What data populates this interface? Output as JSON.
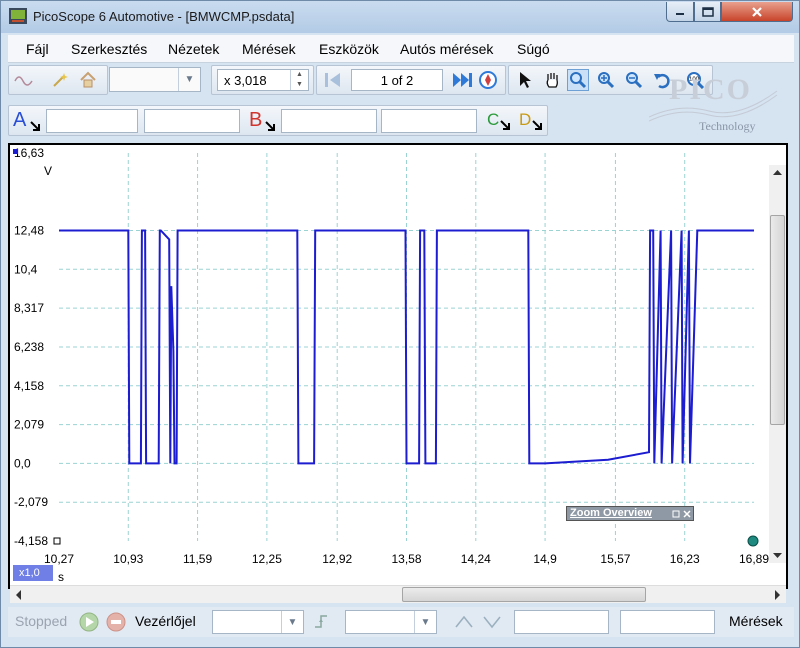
{
  "window": {
    "title": "PicoScope 6 Automotive - [BMWCMP.psdata]"
  },
  "menu": [
    "Fájl",
    "Szerkesztés",
    "Nézetek",
    "Mérések",
    "Eszközök",
    "Autós mérések",
    "Súgó"
  ],
  "toolbar": {
    "zoom_value": "x 3,018",
    "page_indicator": "1 of 2",
    "channel_a": "A",
    "channel_b": "B",
    "channel_c": "C",
    "channel_d": "D",
    "logo_text": "PICO",
    "logo_sub": "Technology"
  },
  "scope": {
    "y_unit": "V",
    "x_unit": "s",
    "x_multiplier": "x1,0",
    "zoom_overview_label": "Zoom Overview",
    "y_ticks": [
      "16,63",
      "12,48",
      "10,4",
      "8,317",
      "6,238",
      "4,158",
      "2,079",
      "0,0",
      "-2,079",
      "-4,158"
    ],
    "x_ticks": [
      "10,27",
      "10,93",
      "11,59",
      "12,25",
      "12,92",
      "13,58",
      "14,24",
      "14,9",
      "15,57",
      "16,23",
      "16,89"
    ],
    "trace_color": "#1c1cd0",
    "grid_color": "#9bd3d3"
  },
  "statusbar": {
    "state": "Stopped",
    "trigger_label": "Vezérlőjel",
    "measurements_label": "Mérések"
  },
  "chart_data": {
    "type": "line",
    "ylabel": "V",
    "xlabel": "s",
    "xlim": [
      10.27,
      16.89
    ],
    "ylim": [
      -4.158,
      16.63
    ],
    "series": [
      {
        "x": [
          10.27,
          10.93,
          10.94,
          11.05,
          11.06,
          11.09,
          11.1,
          11.22,
          11.23,
          11.24,
          11.32,
          11.33,
          11.34,
          11.36,
          11.37,
          11.39,
          11.4,
          11.6,
          11.61,
          12.54,
          12.55,
          12.7,
          12.71,
          13.57,
          13.58,
          13.7,
          13.71,
          13.75,
          13.76,
          13.86,
          13.87,
          14.74,
          14.75,
          14.8,
          14.9,
          15.5,
          15.89,
          15.9,
          15.93,
          15.94,
          16.0,
          16.01,
          16.1,
          16.11,
          16.2,
          16.21,
          16.27,
          16.28,
          16.35,
          16.36,
          16.89
        ],
        "y": [
          12.48,
          12.48,
          0.0,
          0.0,
          12.48,
          12.48,
          0.0,
          0.0,
          12.48,
          12.48,
          12.0,
          0.0,
          9.5,
          6.0,
          0.0,
          0.0,
          12.48,
          12.48,
          12.48,
          12.48,
          0.0,
          0.0,
          12.48,
          12.48,
          0.0,
          0.0,
          12.48,
          12.48,
          0.0,
          0.0,
          12.48,
          12.48,
          0.0,
          0.0,
          0.0,
          0.2,
          0.6,
          12.48,
          12.48,
          0.0,
          12.48,
          0.0,
          12.48,
          0.0,
          12.48,
          0.0,
          12.48,
          0.0,
          12.48,
          12.48,
          12.48
        ]
      }
    ]
  }
}
